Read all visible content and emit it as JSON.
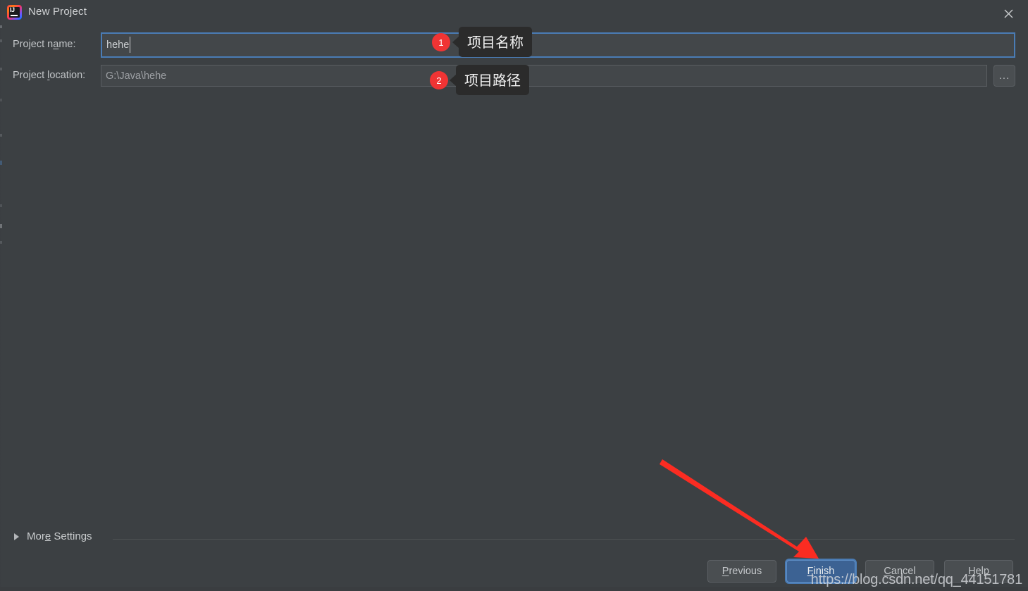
{
  "window": {
    "title": "New Project",
    "app_icon": "intellij-idea-icon",
    "close_icon": "close-icon",
    "background_color": "#3c4043"
  },
  "form": {
    "name_field": {
      "label_prefix": "Project n",
      "label_mnemonic": "a",
      "label_suffix": "me:",
      "value": "hehe",
      "placeholder": "Project name"
    },
    "location_field": {
      "label_prefix": "Project ",
      "label_mnemonic": "l",
      "label_suffix": "ocation:",
      "value": "G:\\Java\\hehe",
      "placeholder": "Project location",
      "browse_label": "...",
      "browse_icon": "ellipsis-icon"
    }
  },
  "annotations": [
    {
      "number": "1",
      "tooltip": "项目名称",
      "target": "project-name-field"
    },
    {
      "number": "2",
      "tooltip": "项目路径",
      "target": "project-location-field"
    }
  ],
  "more_settings": {
    "label": "More Settings",
    "label_prefix": "Mor",
    "label_mnemonic": "e",
    "label_suffix": " Settings",
    "expanded": false,
    "chevron_icon": "triangle-right-icon"
  },
  "buttons": [
    {
      "id": "previous",
      "mnemonic": "P",
      "rest": "revious",
      "primary": false
    },
    {
      "id": "finish",
      "mnemonic": "F",
      "rest": "inish",
      "primary": true
    },
    {
      "id": "cancel",
      "mnemonic": "C",
      "rest": "ancel",
      "primary": false
    },
    {
      "id": "help",
      "mnemonic": "H",
      "rest": "elp",
      "primary": false
    }
  ],
  "accent": {
    "focus_blue": "#4a7cb5",
    "primary_blue": "#3c6293",
    "badge_red": "#f03434",
    "arrow_red": "#fb2c22"
  },
  "watermark": {
    "text": "https://blog.csdn.net/qq_44151781"
  }
}
